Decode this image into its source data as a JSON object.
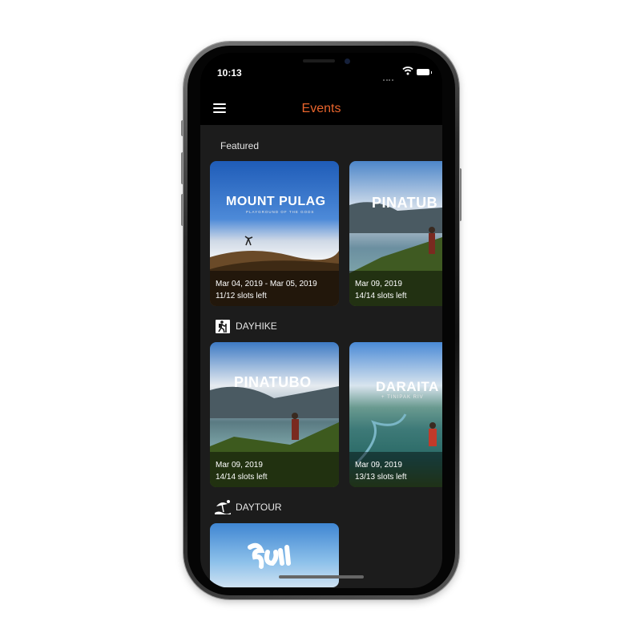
{
  "status": {
    "time": "10:13"
  },
  "nav": {
    "title": "Events",
    "title_color": "#e8642c",
    "menu_icon": "hamburger-menu-icon"
  },
  "sections": [
    {
      "title": "Featured",
      "icon": null,
      "cards": [
        {
          "name": "MOUNT PULAG",
          "subtitle": "PLAYGROUND OF THE GODS",
          "date": "Mar 04, 2019 - Mar 05, 2019",
          "slots": "11/12 slots left"
        },
        {
          "name": "PINATUB",
          "subtitle": "",
          "date": "Mar 09, 2019",
          "slots": "14/14 slots left"
        }
      ]
    },
    {
      "title": "DAYHIKE",
      "icon": "hiker-icon",
      "cards": [
        {
          "name": "PINATUBO",
          "subtitle": "",
          "date": "Mar 09, 2019",
          "slots": "14/14 slots left"
        },
        {
          "name": "DARAITA",
          "subtitle": "+ TINIPAK RIV",
          "date": "Mar 09, 2019",
          "slots": "13/13 slots left"
        }
      ]
    },
    {
      "title": "DAYTOUR",
      "icon": "beach-umbrella-icon",
      "cards": [
        {
          "name": "",
          "subtitle": ""
        }
      ]
    }
  ]
}
